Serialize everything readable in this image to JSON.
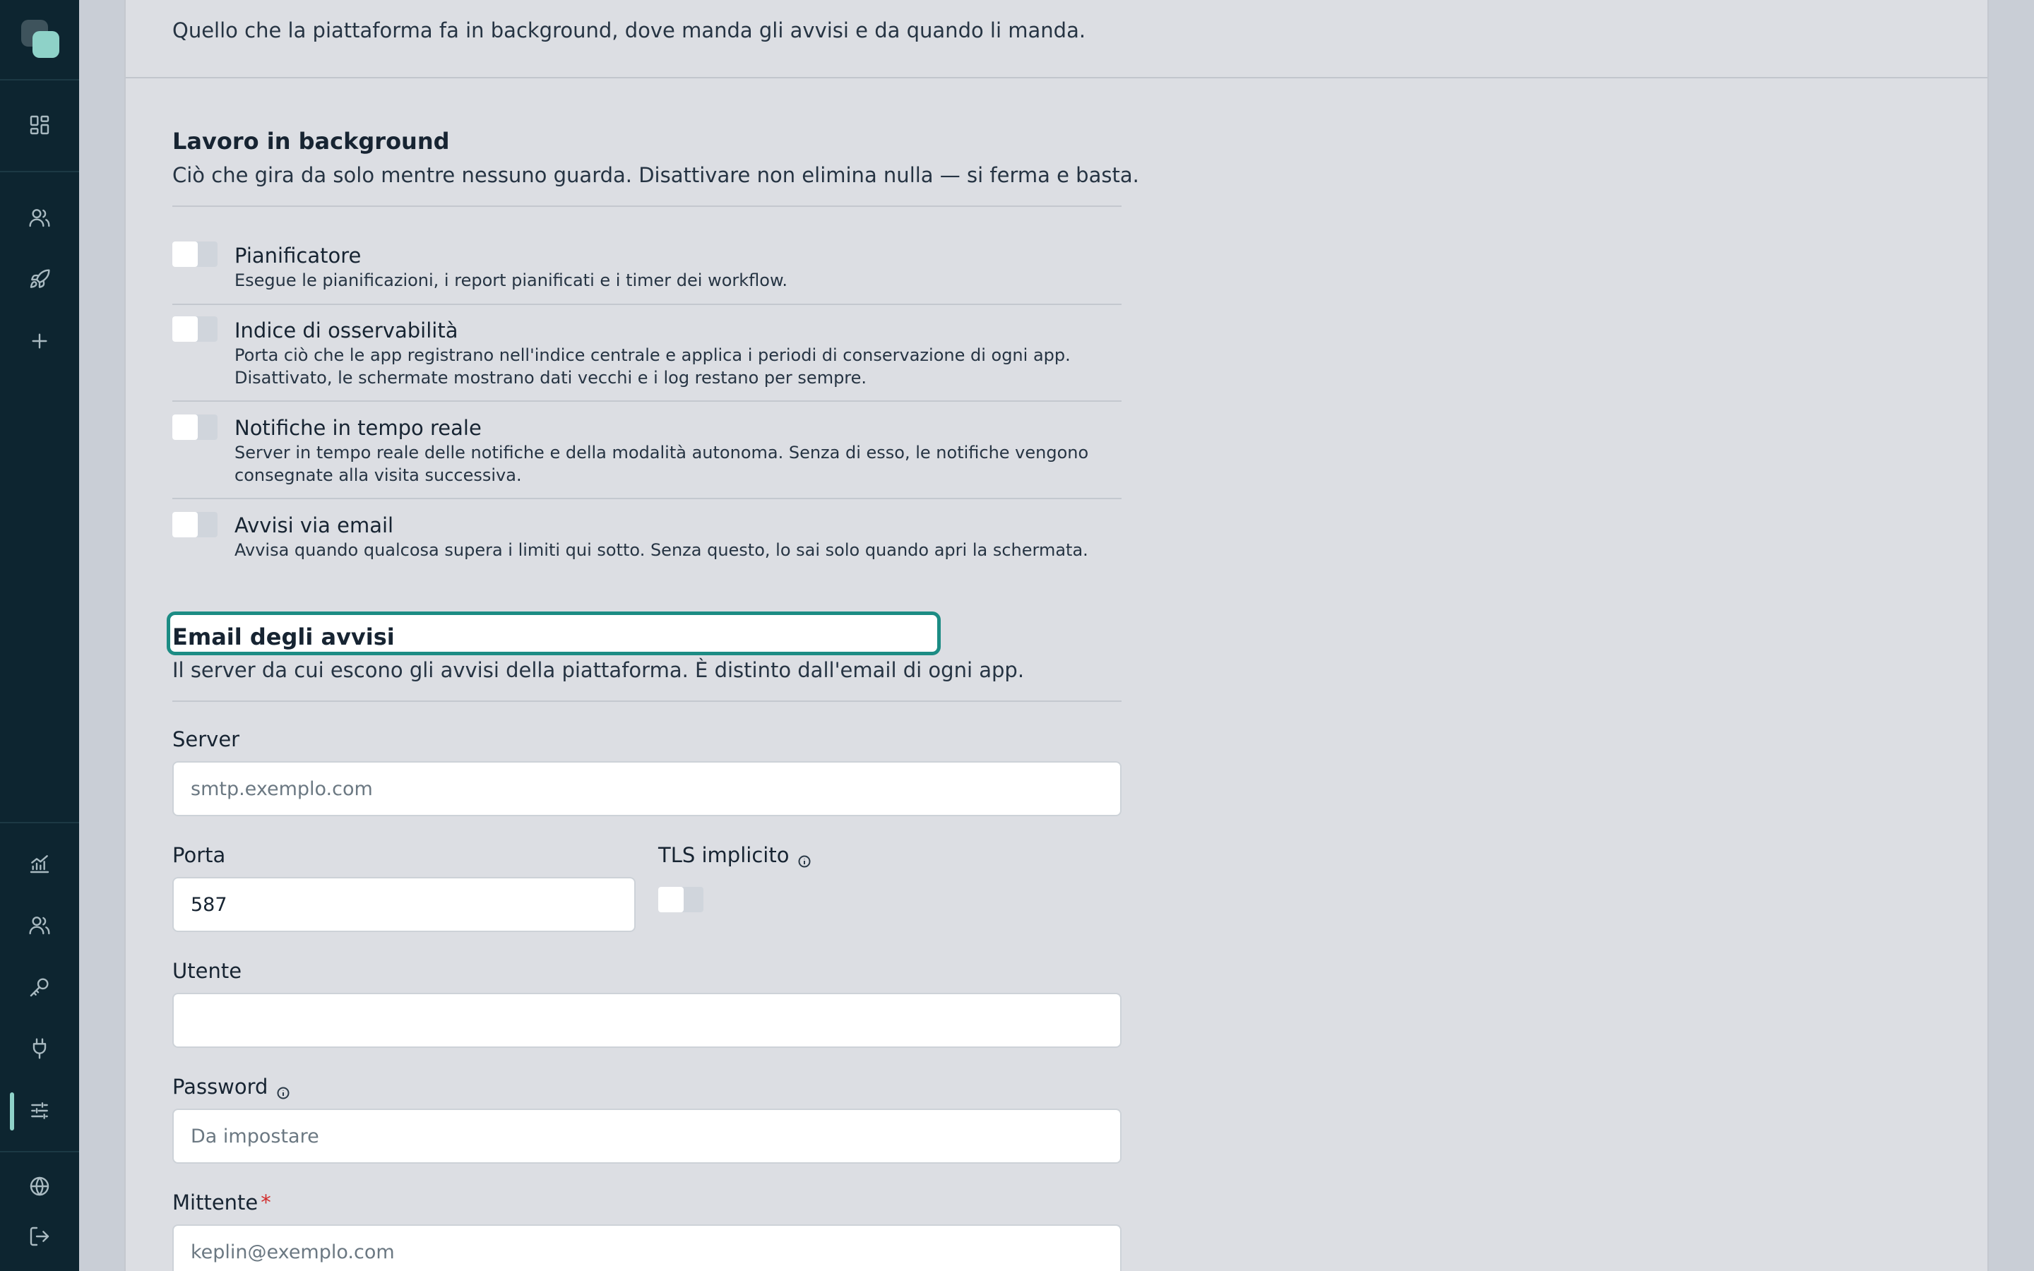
{
  "header": {
    "description": "Quello che la piattaforma fa in background, dove manda gli avvisi e da quando li manda."
  },
  "sidebar": {
    "top_items": [
      {
        "icon": "dashboard-icon"
      },
      {
        "icon": "users-icon"
      },
      {
        "icon": "rocket-icon"
      },
      {
        "icon": "plus-icon"
      }
    ],
    "bottom_items": [
      {
        "icon": "analytics-icon"
      },
      {
        "icon": "team-icon"
      },
      {
        "icon": "key-icon"
      },
      {
        "icon": "plug-icon"
      },
      {
        "icon": "sliders-icon",
        "active": true
      },
      {
        "icon": "globe-icon"
      },
      {
        "icon": "logout-icon"
      }
    ],
    "accent_color": "#8ed2c8"
  },
  "background": {
    "title": "Lavoro in background",
    "description": "Ciò che gira da solo mentre nessuno guarda. Disattivare non elimina nulla — si ferma e basta.",
    "options": [
      {
        "title": "Pianificatore",
        "description": "Esegue le pianificazioni, i report pianificati e i timer dei workflow.",
        "enabled": false
      },
      {
        "title": "Indice di osservabilità",
        "description": "Porta ciò che le app registrano nell'indice centrale e applica i periodi di conservazione di ogni app. Disattivato, le schermate mostrano dati vecchi e i log restano per sempre.",
        "enabled": false
      },
      {
        "title": "Notifiche in tempo reale",
        "description": "Server in tempo reale delle notifiche e della modalità autonoma. Senza di esso, le notifiche vengono consegnate alla visita successiva.",
        "enabled": false
      },
      {
        "title": "Avvisi via email",
        "description": "Avvisa quando qualcosa supera i limiti qui sotto. Senza questo, lo sai solo quando apri la schermata.",
        "enabled": false
      }
    ]
  },
  "alert_email": {
    "title": "Email degli avvisi",
    "description": "Il server da cui escono gli avvisi della piattaforma. È distinto dall'email di ogni app.",
    "server": {
      "label": "Server",
      "value": "",
      "placeholder": "smtp.exemplo.com"
    },
    "port": {
      "label": "Porta",
      "value": "587"
    },
    "tls": {
      "label": "TLS implicito",
      "enabled": false
    },
    "user": {
      "label": "Utente",
      "value": "",
      "placeholder": ""
    },
    "password": {
      "label": "Password",
      "value": "",
      "placeholder": "Da impostare"
    },
    "sender": {
      "label": "Mittente",
      "required_mark": "*",
      "value": "",
      "placeholder": "keplin@exemplo.com"
    }
  },
  "colors": {
    "focus_ring": "#1c8c84",
    "required": "#d22c2c",
    "sidebar_bg": "#0d2530"
  }
}
